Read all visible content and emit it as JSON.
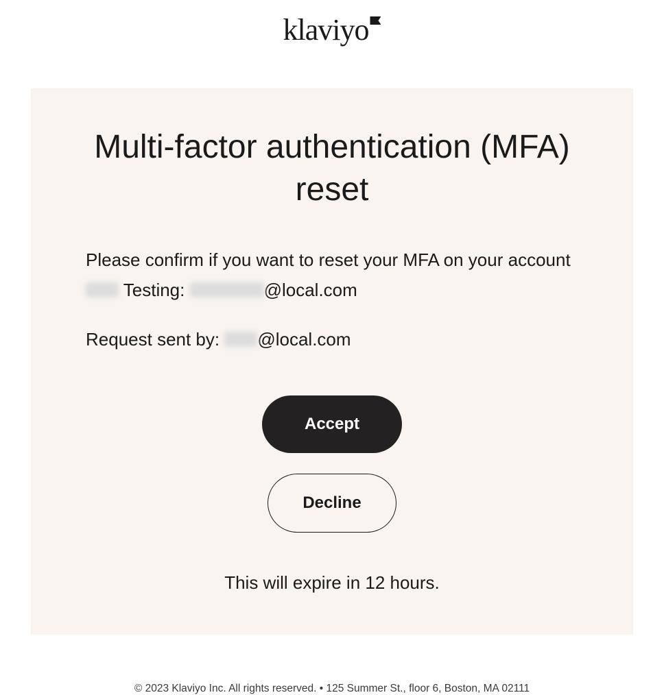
{
  "logo": {
    "text": "klaviyo"
  },
  "card": {
    "heading": "Multi-factor authentication (MFA) reset",
    "intro_prefix": "Please confirm if you want to reset your MFA on your account ",
    "intro_mid": " Testing: ",
    "intro_suffix": "@local.com",
    "request_prefix": "Request sent by: ",
    "request_suffix": "@local.com",
    "accept_label": "Accept",
    "decline_label": "Decline",
    "expiry_text": "This will expire in 12 hours."
  },
  "footer": {
    "text": "© 2023 Klaviyo Inc. All rights reserved. • 125 Summer St., floor 6, Boston, MA 02111"
  }
}
